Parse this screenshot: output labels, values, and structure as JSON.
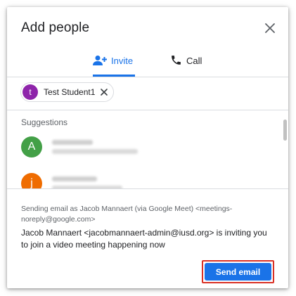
{
  "dialog": {
    "title": "Add people",
    "close_icon": "close-icon"
  },
  "tabs": [
    {
      "label": "Invite",
      "icon": "person-add-icon",
      "active": true
    },
    {
      "label": "Call",
      "icon": "phone-icon",
      "active": false
    }
  ],
  "recipients": [
    {
      "initial": "t",
      "name": "Test Student1",
      "avatar_color": "#8e24aa"
    }
  ],
  "suggestions": {
    "title": "Suggestions",
    "items": [
      {
        "initial": "A",
        "avatar_color": "#43a047",
        "blurred": true
      },
      {
        "initial": "j",
        "avatar_color": "#ef6c00",
        "blurred": true
      }
    ]
  },
  "footer": {
    "sender_line": "Sending email as Jacob Mannaert (via Google Meet) <meetings-noreply@google.com>",
    "message": "Jacob Mannaert <jacobmannaert-admin@iusd.org> is inviting you to join a video meeting happening now",
    "send_label": "Send email"
  },
  "colors": {
    "accent": "#1a73e8",
    "highlight_outline": "#d93025"
  }
}
